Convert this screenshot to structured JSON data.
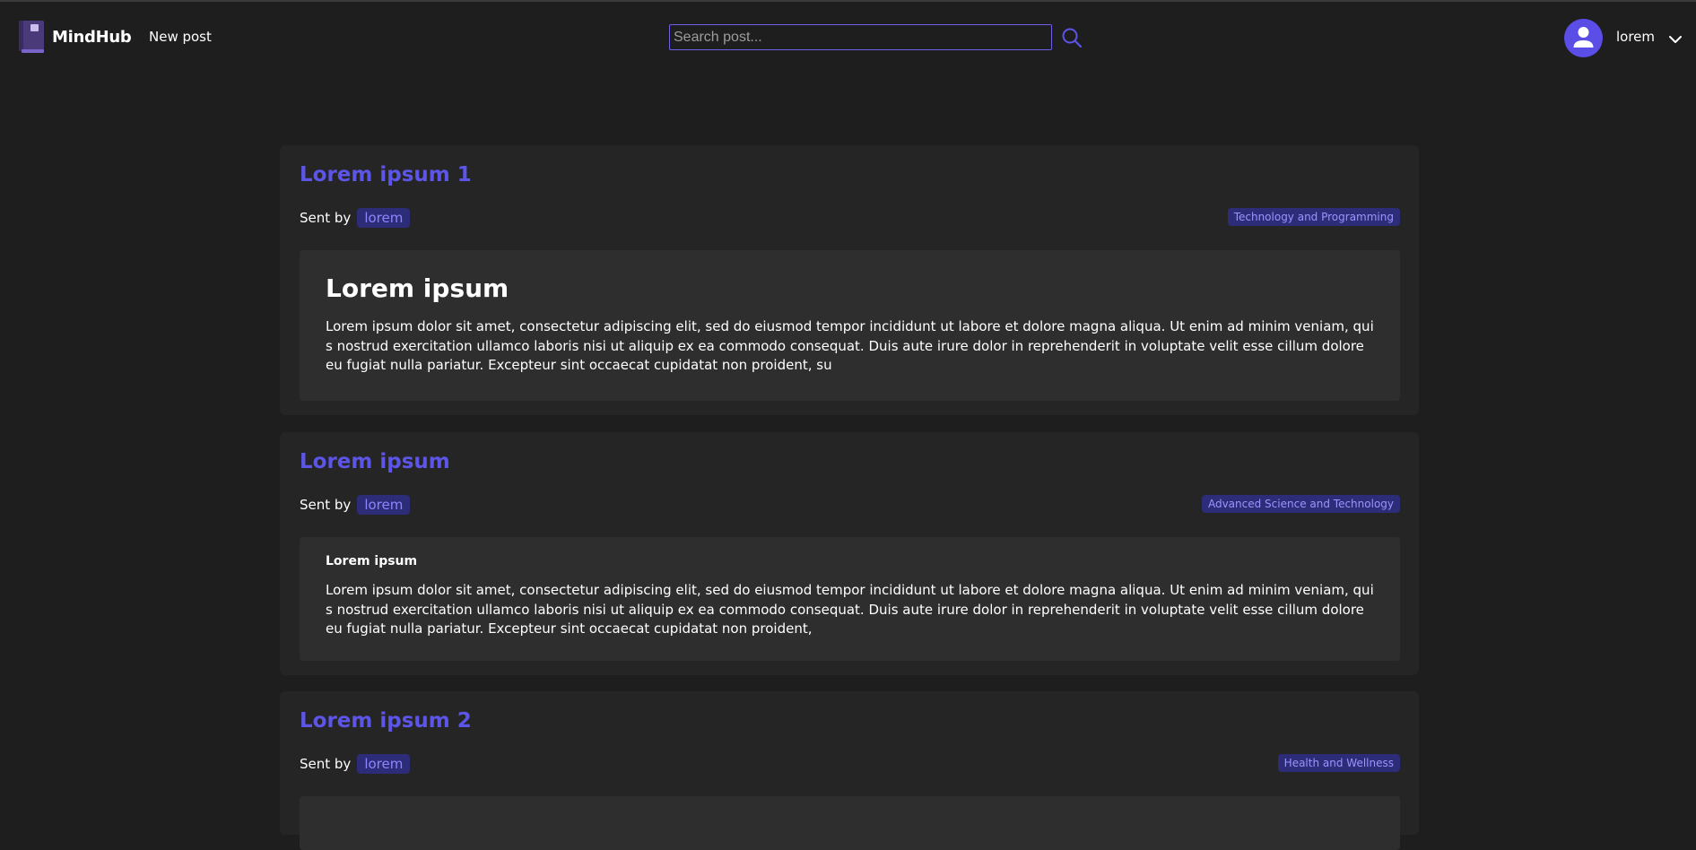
{
  "header": {
    "brand": "MindHub",
    "new_post_label": "New post",
    "search_placeholder": "Search post...",
    "username": "lorem",
    "accent_color": "#5c55e8"
  },
  "posts": [
    {
      "title": "Lorem ipsum 1",
      "sent_by_label": "Sent by",
      "author": "lorem",
      "category": "Technology and Programming",
      "content_heading": "Lorem ipsum",
      "content_text": "Lorem ipsum dolor sit amet, consectetur adipiscing elit, sed do eiusmod tempor incididunt ut labore et dolore magna aliqua. Ut enim ad minim veniam, quis nostrud exercitation ullamco laboris nisi ut aliquip ex ea commodo consequat. Duis aute irure dolor in reprehenderit in voluptate velit esse cillum dolore eu fugiat nulla pariatur. Excepteur sint occaecat cupidatat non proident, su"
    },
    {
      "title": "Lorem ipsum",
      "sent_by_label": "Sent by",
      "author": "lorem",
      "category": "Advanced Science and Technology",
      "content_heading": "Lorem ipsum",
      "content_text": "Lorem ipsum dolor sit amet, consectetur adipiscing elit, sed do eiusmod tempor incididunt ut labore et dolore magna aliqua. Ut enim ad minim veniam, quis nostrud exercitation ullamco laboris nisi ut aliquip ex ea commodo consequat. Duis aute irure dolor in reprehenderit in voluptate velit esse cillum dolore eu fugiat nulla pariatur. Excepteur sint occaecat cupidatat non proident,"
    },
    {
      "title": "Lorem ipsum 2",
      "sent_by_label": "Sent by",
      "author": "lorem",
      "category": "Health and Wellness"
    }
  ]
}
